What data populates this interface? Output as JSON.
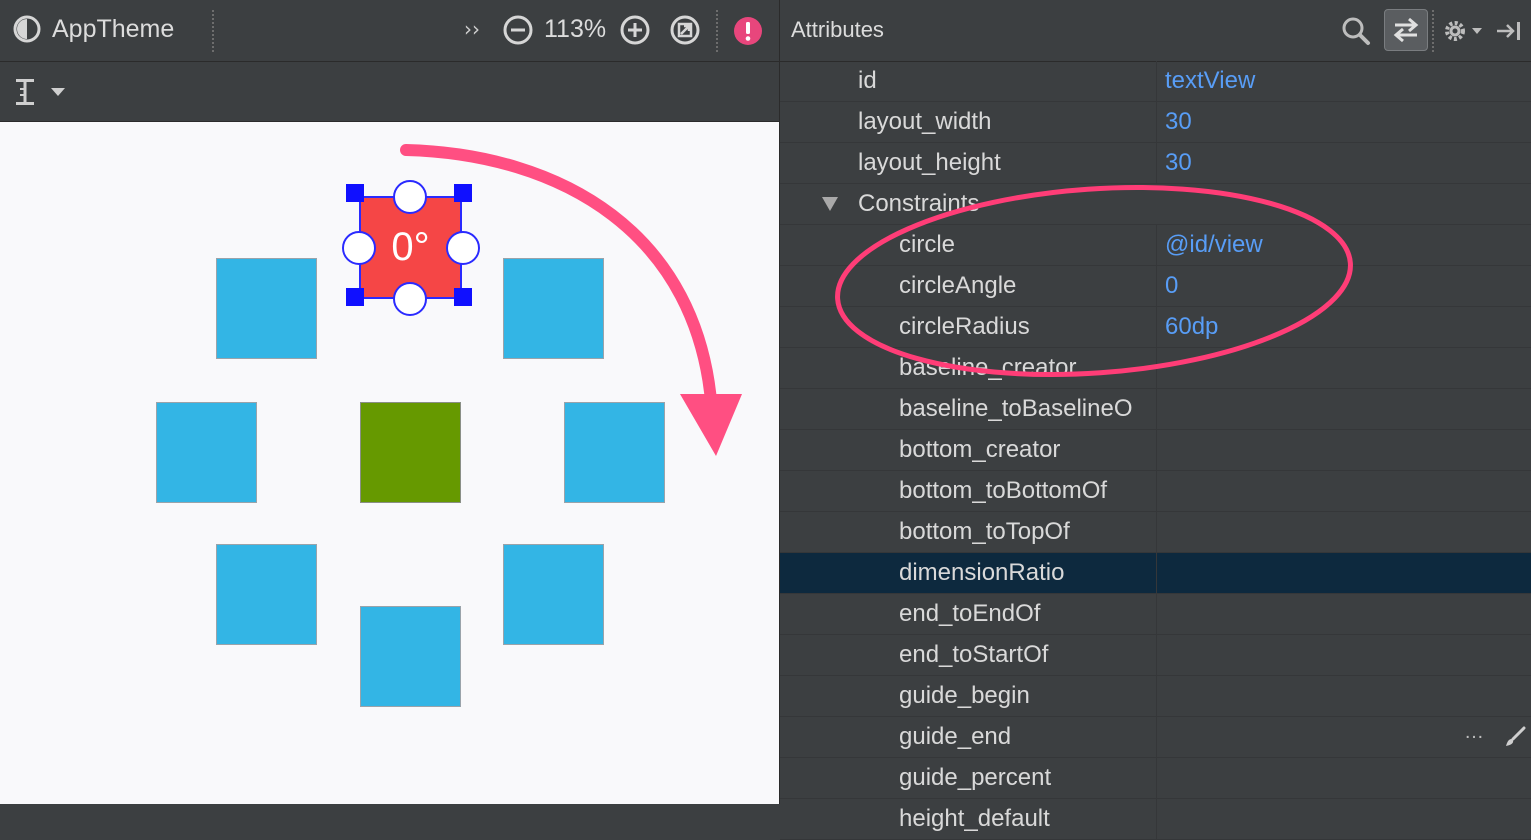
{
  "toolbar": {
    "theme_label": "AppTheme",
    "overflow_glyph": "››",
    "zoom_level": "113%",
    "zoom_out_icon": "minus-circle-icon",
    "zoom_in_icon": "plus-circle-icon",
    "zoom_fit_icon": "zoom-fit-icon",
    "error_icon": "error-icon",
    "error_color": "#e8467c"
  },
  "canvas": {
    "selected_label": "0°",
    "colors": {
      "satellite": "#33b5e5",
      "center": "#669900",
      "selected": "#f54646",
      "handles": "#1010ff",
      "arrow": "#ff4f82"
    }
  },
  "attributes": {
    "title": "Attributes",
    "rows": [
      {
        "name": "id",
        "value": "textView",
        "indent": 1
      },
      {
        "name": "layout_width",
        "value": "30",
        "indent": 1
      },
      {
        "name": "layout_height",
        "value": "30",
        "indent": 1
      },
      {
        "name": "Constraints",
        "value": "",
        "indent": 1,
        "group": true
      },
      {
        "name": "circle",
        "value": "@id/view",
        "indent": 2
      },
      {
        "name": "circleAngle",
        "value": "0",
        "indent": 2
      },
      {
        "name": "circleRadius",
        "value": "60dp",
        "indent": 2
      },
      {
        "name": "baseline_creator",
        "value": "",
        "indent": 2
      },
      {
        "name": "baseline_toBaselineO",
        "value": "",
        "indent": 2
      },
      {
        "name": "bottom_creator",
        "value": "",
        "indent": 2
      },
      {
        "name": "bottom_toBottomOf",
        "value": "",
        "indent": 2
      },
      {
        "name": "bottom_toTopOf",
        "value": "",
        "indent": 2
      },
      {
        "name": "dimensionRatio",
        "value": "",
        "indent": 2,
        "selected": true
      },
      {
        "name": "end_toEndOf",
        "value": "",
        "indent": 2
      },
      {
        "name": "end_toStartOf",
        "value": "",
        "indent": 2
      },
      {
        "name": "guide_begin",
        "value": "",
        "indent": 2
      },
      {
        "name": "guide_end",
        "value": "",
        "indent": 2,
        "actions": true
      },
      {
        "name": "guide_percent",
        "value": "",
        "indent": 2
      },
      {
        "name": "height_default",
        "value": "",
        "indent": 2
      }
    ],
    "row_actions_glyph": "…",
    "value_color": "#589df6",
    "highlight_color": "#ff3d77"
  }
}
